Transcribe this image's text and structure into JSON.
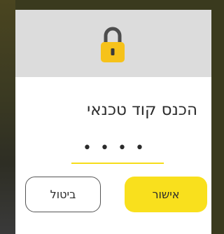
{
  "dialog": {
    "title": "הכנס קוד טכנאי",
    "pin_value": "••••",
    "confirm_label": "אישור",
    "cancel_label": "ביטול",
    "icon": "lock-icon"
  },
  "colors": {
    "accent": "#f9e01d",
    "header_bg": "#dcdcdc",
    "lock_body": "#f6c21a",
    "lock_shackle": "#4d4d4d"
  }
}
